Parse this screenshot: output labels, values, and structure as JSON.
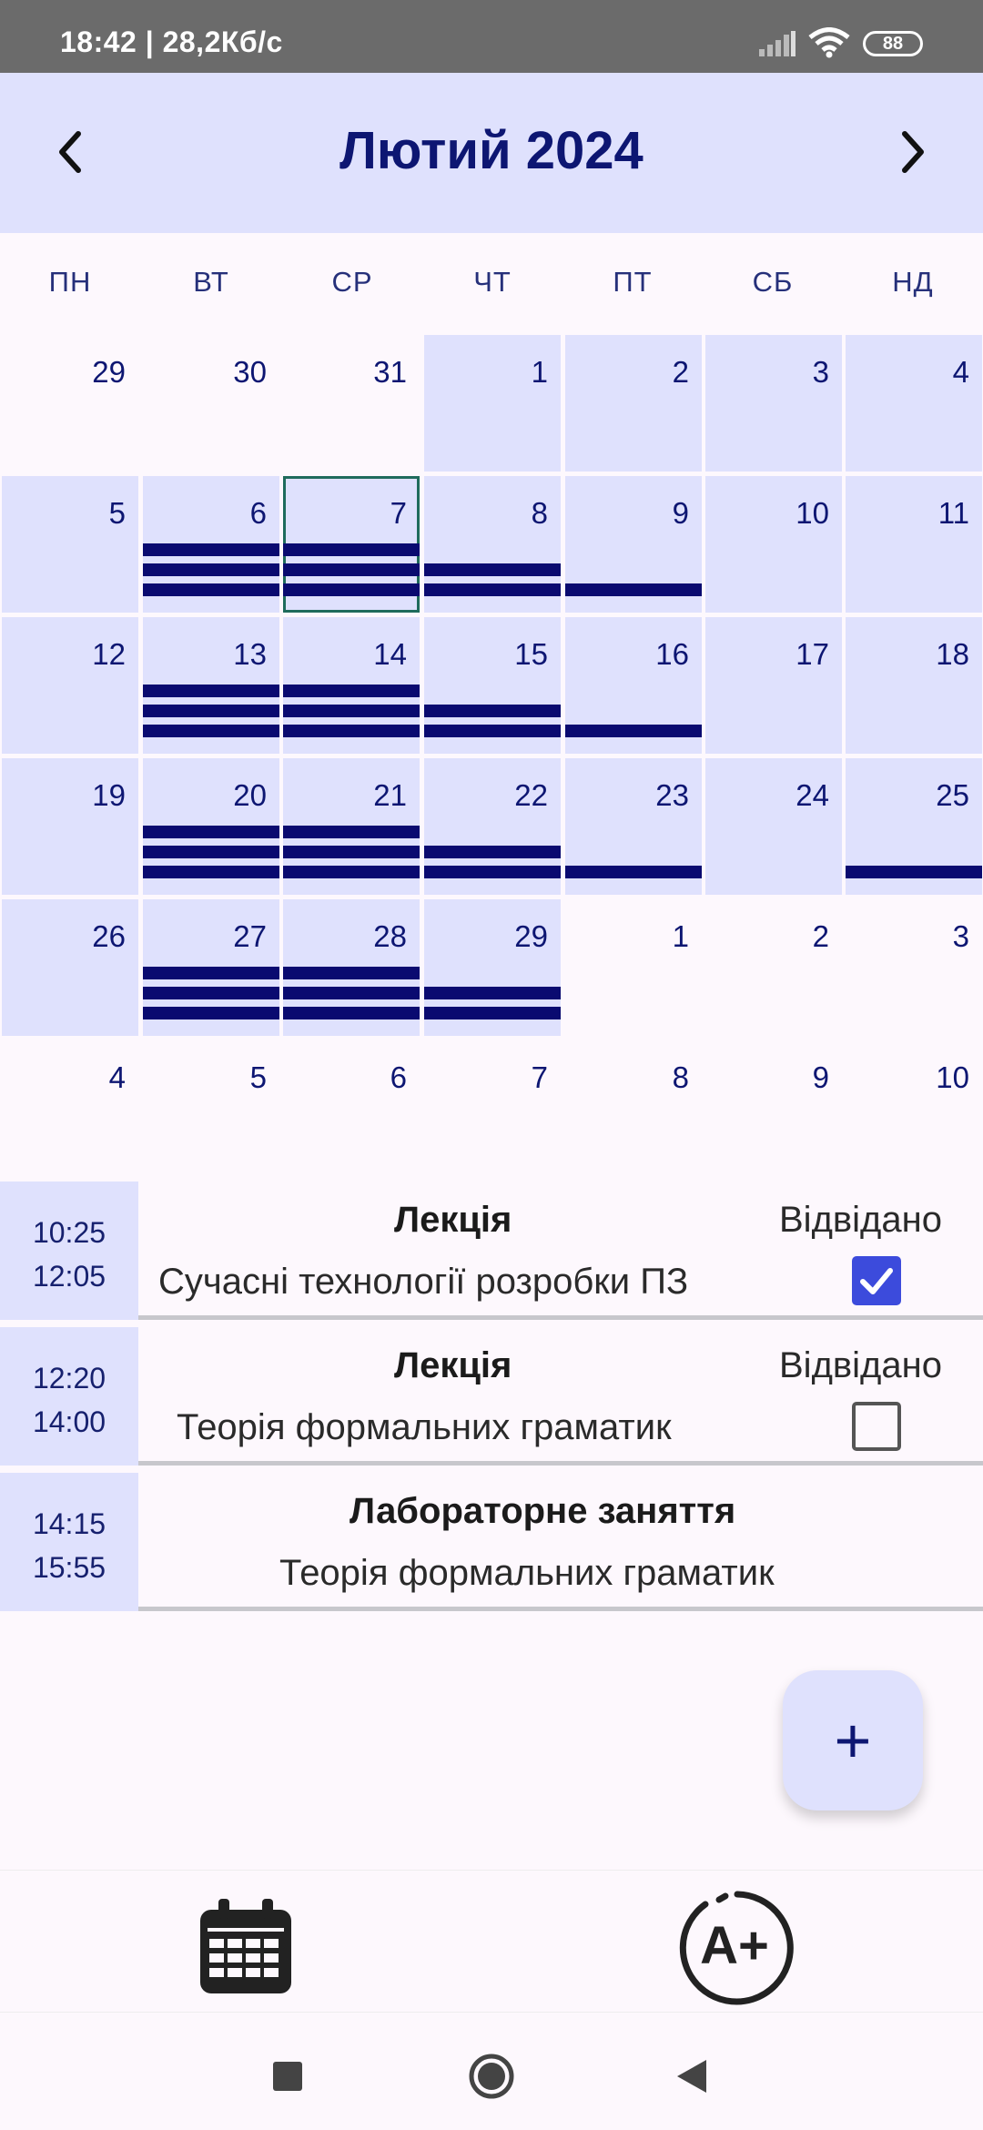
{
  "status_bar": {
    "time": "18:42 | 28,2Кб/с",
    "battery": "88"
  },
  "header": {
    "title": "Лютий 2024",
    "prev_icon": "chevron-left-icon",
    "next_icon": "chevron-right-icon"
  },
  "weekdays": [
    "ПН",
    "ВТ",
    "СР",
    "ЧТ",
    "ПТ",
    "СБ",
    "НД"
  ],
  "calendar": {
    "selected_day": "7",
    "rows": [
      [
        {
          "d": "29",
          "bg": false,
          "bars": 0
        },
        {
          "d": "30",
          "bg": false,
          "bars": 0
        },
        {
          "d": "31",
          "bg": false,
          "bars": 0
        },
        {
          "d": "1",
          "bg": true,
          "bars": 0
        },
        {
          "d": "2",
          "bg": true,
          "bars": 0
        },
        {
          "d": "3",
          "bg": true,
          "bars": 0
        },
        {
          "d": "4",
          "bg": true,
          "bars": 0
        }
      ],
      [
        {
          "d": "5",
          "bg": true,
          "bars": 0
        },
        {
          "d": "6",
          "bg": true,
          "bars": 3
        },
        {
          "d": "7",
          "bg": true,
          "bars": 3,
          "selected": true
        },
        {
          "d": "8",
          "bg": true,
          "bars": 2
        },
        {
          "d": "9",
          "bg": true,
          "bars": 1
        },
        {
          "d": "10",
          "bg": true,
          "bars": 0
        },
        {
          "d": "11",
          "bg": true,
          "bars": 0
        }
      ],
      [
        {
          "d": "12",
          "bg": true,
          "bars": 0
        },
        {
          "d": "13",
          "bg": true,
          "bars": 3
        },
        {
          "d": "14",
          "bg": true,
          "bars": 3
        },
        {
          "d": "15",
          "bg": true,
          "bars": 2
        },
        {
          "d": "16",
          "bg": true,
          "bars": 1
        },
        {
          "d": "17",
          "bg": true,
          "bars": 0
        },
        {
          "d": "18",
          "bg": true,
          "bars": 0
        }
      ],
      [
        {
          "d": "19",
          "bg": true,
          "bars": 0
        },
        {
          "d": "20",
          "bg": true,
          "bars": 3
        },
        {
          "d": "21",
          "bg": true,
          "bars": 3
        },
        {
          "d": "22",
          "bg": true,
          "bars": 2
        },
        {
          "d": "23",
          "bg": true,
          "bars": 1
        },
        {
          "d": "24",
          "bg": true,
          "bars": 0
        },
        {
          "d": "25",
          "bg": true,
          "bars": 1
        }
      ],
      [
        {
          "d": "26",
          "bg": true,
          "bars": 0
        },
        {
          "d": "27",
          "bg": true,
          "bars": 3
        },
        {
          "d": "28",
          "bg": true,
          "bars": 3
        },
        {
          "d": "29",
          "bg": true,
          "bars": 2
        },
        {
          "d": "1",
          "bg": false,
          "bars": 0
        },
        {
          "d": "2",
          "bg": false,
          "bars": 0
        },
        {
          "d": "3",
          "bg": false,
          "bars": 0
        }
      ],
      [
        {
          "d": "4",
          "bg": false,
          "bars": 0
        },
        {
          "d": "5",
          "bg": false,
          "bars": 0
        },
        {
          "d": "6",
          "bg": false,
          "bars": 0
        },
        {
          "d": "7",
          "bg": false,
          "bars": 0
        },
        {
          "d": "8",
          "bg": false,
          "bars": 0
        },
        {
          "d": "9",
          "bg": false,
          "bars": 0
        },
        {
          "d": "10",
          "bg": false,
          "bars": 0
        }
      ]
    ]
  },
  "lessons": [
    {
      "start": "10:25",
      "end": "12:05",
      "type": "Лекція",
      "name": "Сучасні технології розробки ПЗ",
      "attendance_label": "Відвідано",
      "attended": true
    },
    {
      "start": "12:20",
      "end": "14:00",
      "type": "Лекція",
      "name": "Теорія формальних граматик",
      "attendance_label": "Відвідано",
      "attended": false
    },
    {
      "start": "14:15",
      "end": "15:55",
      "type": "Лабораторне заняття",
      "name": "Теорія формальних граматик",
      "attendance_label": "",
      "attended": null
    }
  ],
  "fab": {
    "label": "+"
  },
  "bottom_nav": [
    {
      "icon": "calendar-icon"
    },
    {
      "icon": "grade-a-plus-icon"
    }
  ],
  "system_nav": [
    {
      "icon": "recents-square-icon"
    },
    {
      "icon": "home-circle-icon"
    },
    {
      "icon": "back-triangle-icon"
    }
  ],
  "colors": {
    "accent_bg": "#dfe1fd",
    "accent_text": "#0d1672",
    "bar": "#0a0a70",
    "checkbox": "#3c4bdc",
    "selected_outline": "#1f6b5c"
  }
}
